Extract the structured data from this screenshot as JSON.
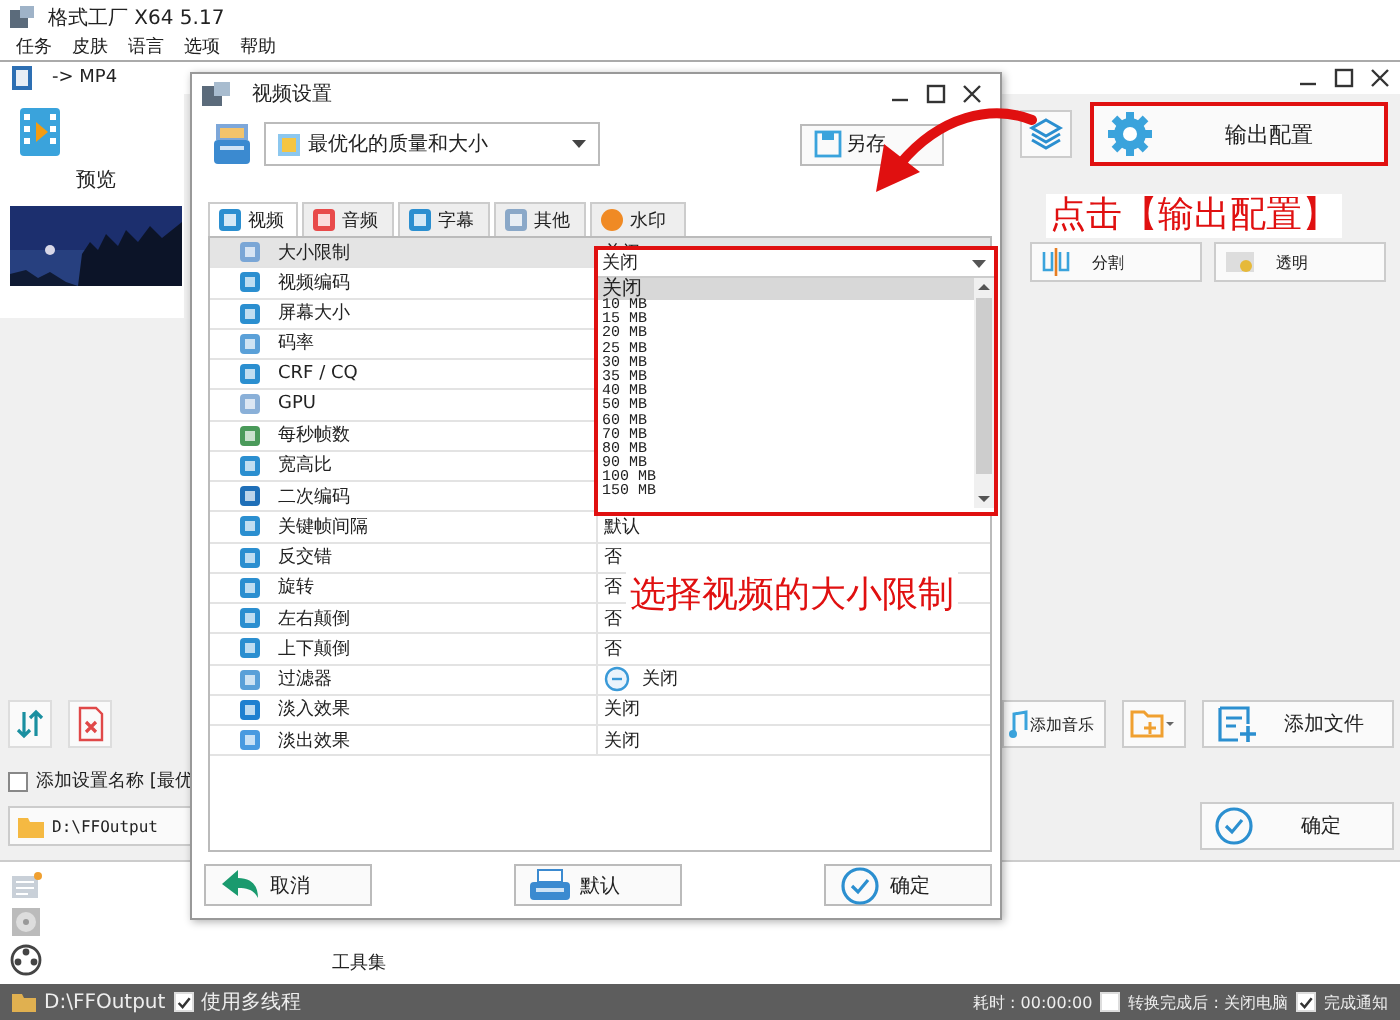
{
  "app": {
    "title": "格式工厂 X64 5.17",
    "menu": [
      "任务",
      "皮肤",
      "语言",
      "选项",
      "帮助"
    ]
  },
  "main_window": {
    "title": "-> MP4",
    "preview_label": "预览",
    "output_config_button": "输出配置",
    "tool_buttons": [
      "分割",
      "透明"
    ],
    "add_setting_name": {
      "label": "添加设置名称 [最优",
      "checked": false
    },
    "output_path": "D:\\FFOutput",
    "add_music_button": "添加音乐",
    "add_file_button": "添加文件",
    "ok_button": "确定",
    "toolbox_label": "工具集"
  },
  "dialog": {
    "title": "视频设置",
    "preset": "最优化的质量和大小",
    "save_as_button": "另存",
    "tabs": [
      {
        "label": "视频",
        "selected": true
      },
      {
        "label": "音频",
        "selected": false
      },
      {
        "label": "字幕",
        "selected": false
      },
      {
        "label": "其他",
        "selected": false
      },
      {
        "label": "水印",
        "selected": false
      }
    ],
    "properties": [
      {
        "name": "大小限制",
        "kind": "text",
        "value": "关闭",
        "selected": true
      },
      {
        "name": "视频编码",
        "kind": "text",
        "selected": false
      },
      {
        "name": "屏幕大小",
        "kind": "text",
        "selected": false
      },
      {
        "name": "码率",
        "kind": "text",
        "selected": false
      },
      {
        "name": "CRF / CQ",
        "kind": "text",
        "selected": false
      },
      {
        "name": "GPU",
        "kind": "text",
        "selected": false
      },
      {
        "name": "每秒帧数",
        "kind": "text",
        "selected": false
      },
      {
        "name": "宽高比",
        "kind": "text",
        "selected": false
      },
      {
        "name": "二次编码",
        "kind": "text",
        "selected": false
      },
      {
        "name": "关键帧间隔",
        "kind": "text",
        "value": "默认",
        "selected": false
      },
      {
        "name": "反交错",
        "kind": "text",
        "value": "否",
        "selected": false
      },
      {
        "name": "旋转",
        "kind": "text",
        "value": "否",
        "selected": false
      },
      {
        "name": "左右颠倒",
        "kind": "text",
        "value": "否",
        "selected": false
      },
      {
        "name": "上下颠倒",
        "kind": "text",
        "value": "否",
        "selected": false
      },
      {
        "name": "过滤器",
        "kind": "switch",
        "value": "关闭",
        "selected": false
      },
      {
        "name": "淡入效果",
        "kind": "text",
        "value": "关闭",
        "selected": false
      },
      {
        "name": "淡出效果",
        "kind": "text",
        "value": "关闭",
        "selected": false
      }
    ],
    "size_options": [
      {
        "label": "关闭",
        "selected": true
      },
      {
        "label": "10 MB",
        "selected": false
      },
      {
        "label": "15 MB",
        "selected": false
      },
      {
        "label": "20 MB",
        "selected": false
      },
      {
        "label": "25 MB",
        "selected": false
      },
      {
        "label": "30 MB",
        "selected": false
      },
      {
        "label": "35 MB",
        "selected": false
      },
      {
        "label": "40 MB",
        "selected": false
      },
      {
        "label": "50 MB",
        "selected": false
      },
      {
        "label": "60 MB",
        "selected": false
      },
      {
        "label": "70 MB",
        "selected": false
      },
      {
        "label": "80 MB",
        "selected": false
      },
      {
        "label": "90 MB",
        "selected": false
      },
      {
        "label": "100 MB",
        "selected": false
      },
      {
        "label": "150 MB",
        "selected": false
      }
    ],
    "buttons": [
      "取消",
      "默认",
      "确定"
    ]
  },
  "annotations": [
    {
      "text": "点击【输出配置】"
    },
    {
      "text": "选择视频的大小限制"
    }
  ],
  "status_bar": {
    "path": "D:\\FFOutput",
    "multithread": {
      "label": "使用多线程",
      "checked": true
    },
    "elapsed": "耗时 : 00:00:00",
    "shutdown": {
      "label": "转换完成后 : 关闭电脑",
      "checked": false
    },
    "notify": {
      "label": "完成通知",
      "checked": true
    }
  }
}
